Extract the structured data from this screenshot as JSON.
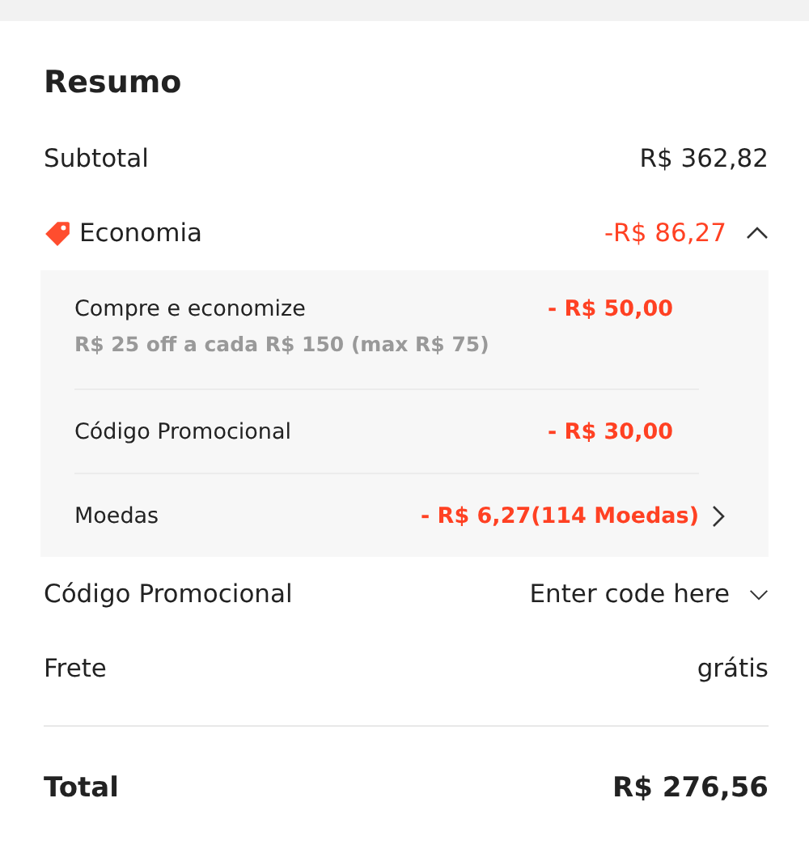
{
  "title": "Resumo",
  "subtotal": {
    "label": "Subtotal",
    "value": "R$ 362,82"
  },
  "savings": {
    "label": "Economia",
    "value": "-R$ 86,27",
    "expanded": true,
    "items": [
      {
        "kind": "note",
        "label": "Compre e economize",
        "value": "- R$ 50,00",
        "note": "R$ 25 off a cada R$ 150 (max R$ 75)"
      },
      {
        "kind": "plain",
        "label": "Código Promocional",
        "value": "- R$ 30,00"
      },
      {
        "kind": "link",
        "label": "Moedas",
        "value": "- R$ 6,27(114 Moedas)"
      }
    ]
  },
  "promo_code": {
    "label": "Código Promocional",
    "placeholder": "Enter code here",
    "expanded": false
  },
  "shipping": {
    "label": "Frete",
    "value": "grátis"
  },
  "total": {
    "label": "Total",
    "value": "R$ 276,56"
  }
}
